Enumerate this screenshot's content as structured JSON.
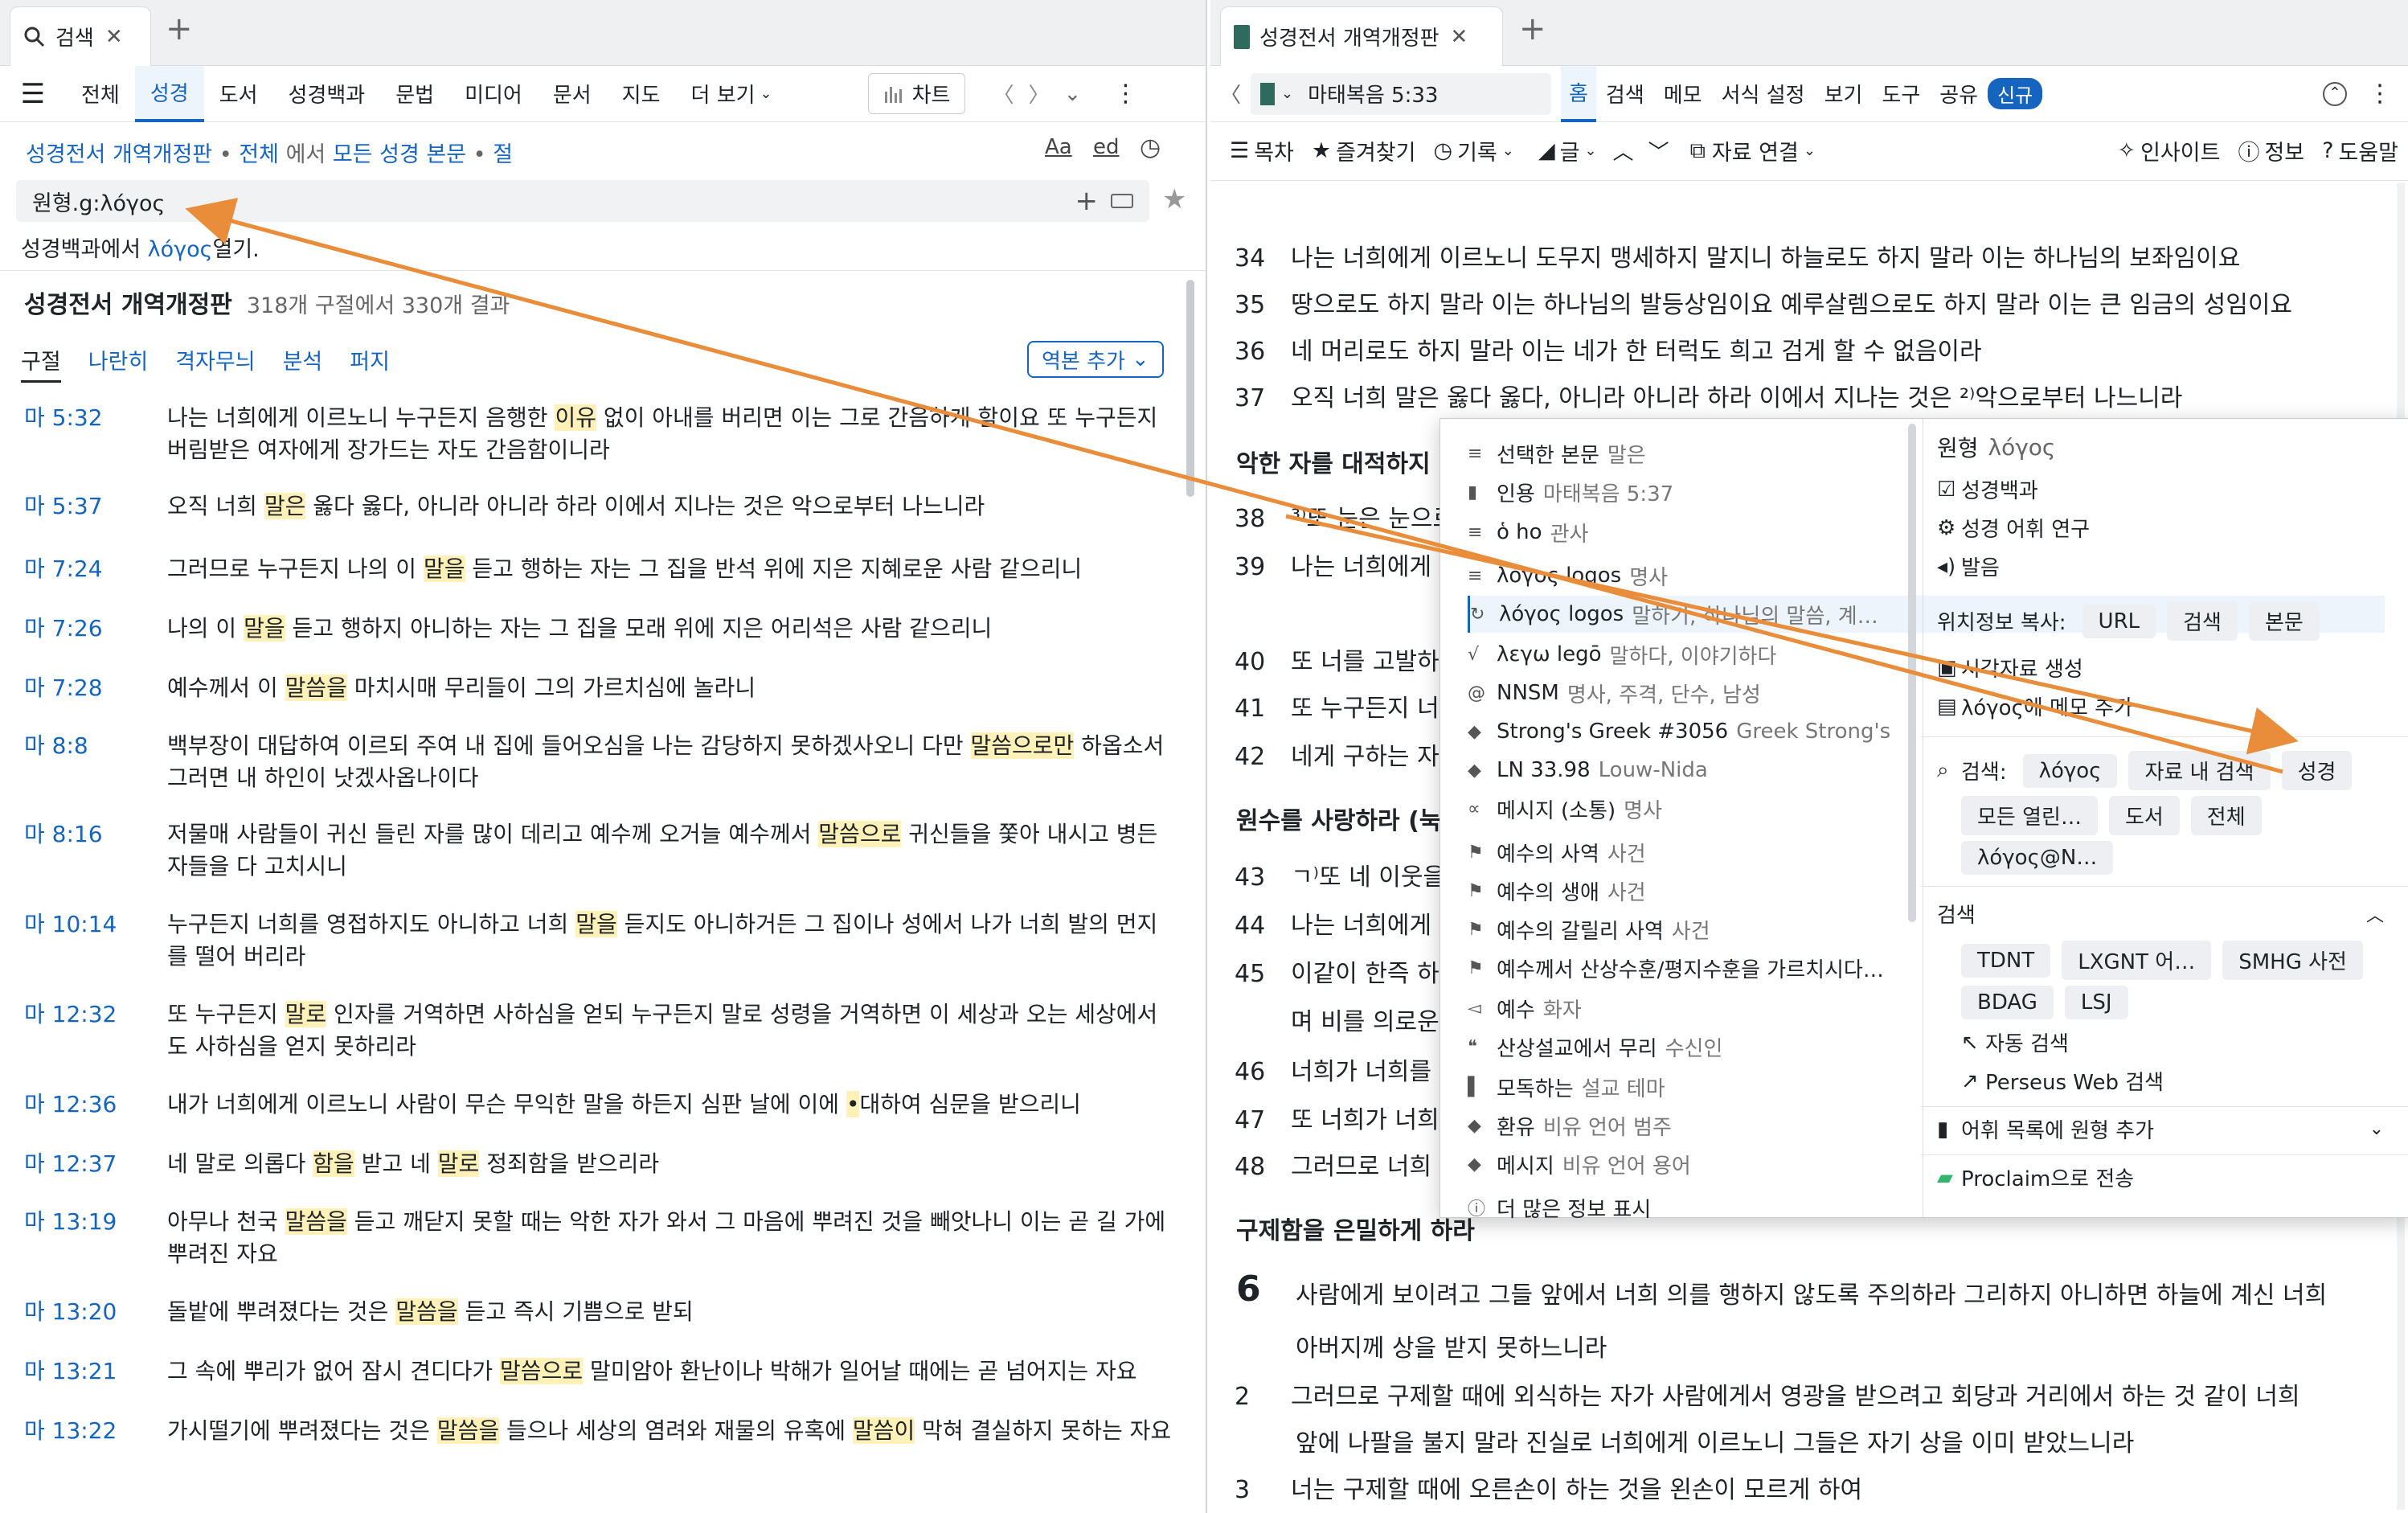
{
  "left": {
    "tab": {
      "title": "검색",
      "close": "✕",
      "new": "+"
    },
    "nav": {
      "menu": "☰",
      "items": [
        "전체",
        "성경",
        "도서",
        "성경백과",
        "문법",
        "미디어",
        "문서",
        "지도",
        "더 보기"
      ],
      "chart": "차트",
      "back": "〈",
      "fwd": "〉",
      "more": "⌄",
      "dots": "⋮"
    },
    "scope": {
      "version": "성경전서 개역개정판",
      "dot": "•",
      "all": "전체",
      "in": "에서",
      "target": "모든 성경 본문",
      "unit": "절",
      "tools": [
        "Aa",
        "ed"
      ]
    },
    "query": {
      "value": "원형.g:λόγος",
      "plus": "+",
      "star": "★"
    },
    "suggest": {
      "pre": "성경백과에서",
      "word": "λόγος",
      "post": "열기."
    },
    "results": {
      "title": "성경전서 개역개정판",
      "count": "318개 구절에서 330개 결과"
    },
    "subtabs": [
      "구절",
      "나란히",
      "격자무늬",
      "분석",
      "퍼지"
    ],
    "add_version": "역본 추가",
    "rows": [
      {
        "ref": "마 5:32",
        "parts": [
          [
            "나는 너희에게 이르노니 누구든지 음행한 ",
            0
          ],
          [
            "이유",
            1
          ],
          [
            " 없이 아내를 버리면 이는 그로 간음하게 함이요 또 누구든지 버림받은 여자에게 장가드는 자도 간음함이니라",
            0
          ]
        ]
      },
      {
        "ref": "마 5:37",
        "parts": [
          [
            "오직 너희 ",
            0
          ],
          [
            "말은",
            1
          ],
          [
            " 옳다 옳다, 아니라 아니라 하라 이에서 지나는 것은 악으로부터 나느니라",
            0
          ]
        ]
      },
      {
        "ref": "마 7:24",
        "parts": [
          [
            "그러므로 누구든지 나의 이 ",
            0
          ],
          [
            "말을",
            1
          ],
          [
            " 듣고 행하는 자는 그 집을 반석 위에 지은 지혜로운 사람 같으리니",
            0
          ]
        ]
      },
      {
        "ref": "마 7:26",
        "parts": [
          [
            "나의 이 ",
            0
          ],
          [
            "말을",
            1
          ],
          [
            " 듣고 행하지 아니하는 자는 그 집을 모래 위에 지은 어리석은 사람 같으리니",
            0
          ]
        ]
      },
      {
        "ref": "마 7:28",
        "parts": [
          [
            "예수께서 이 ",
            0
          ],
          [
            "말씀을",
            1
          ],
          [
            " 마치시매 무리들이 그의 가르치심에 놀라니",
            0
          ]
        ]
      },
      {
        "ref": "마 8:8",
        "parts": [
          [
            "백부장이 대답하여 이르되 주여 내 집에 들어오심을 나는 감당하지 못하겠사오니 다만 ",
            0
          ],
          [
            "말씀으로만",
            1
          ],
          [
            " 하옵소서 그러면 내 하인이 낫겠사옵나이다",
            0
          ]
        ]
      },
      {
        "ref": "마 8:16",
        "parts": [
          [
            "저물매 사람들이 귀신 들린 자를 많이 데리고 예수께 오거늘 예수께서 ",
            0
          ],
          [
            "말씀으로",
            1
          ],
          [
            " 귀신들을 쫓아 내시고 병든 자들을 다 고치시니",
            0
          ]
        ]
      },
      {
        "ref": "마 10:14",
        "parts": [
          [
            "누구든지 너희를 영접하지도 아니하고 너희 ",
            0
          ],
          [
            "말을",
            1
          ],
          [
            " 듣지도 아니하거든 그 집이나 성에서 나가 너희 발의 먼지를 떨어 버리라",
            0
          ]
        ]
      },
      {
        "ref": "마 12:32",
        "parts": [
          [
            "또 누구든지 ",
            0
          ],
          [
            "말로",
            1
          ],
          [
            " 인자를 거역하면 사하심을 얻되 누구든지 말로 성령을 거역하면 이 세상과 오는 세상에서도 사하심을 얻지 못하리라",
            0
          ]
        ]
      },
      {
        "ref": "마 12:36",
        "parts": [
          [
            "내가 너희에게 이르노니 사람이 무슨 무익한 말을 하든지 심판 날에 이에 ",
            0
          ],
          [
            "•",
            1
          ],
          [
            "대하여 심문을 받으리니",
            0
          ]
        ]
      },
      {
        "ref": "마 12:37",
        "parts": [
          [
            "네 말로 의롭다 ",
            0
          ],
          [
            "함을",
            1
          ],
          [
            " 받고 네 ",
            0
          ],
          [
            "말로",
            1
          ],
          [
            " 정죄함을 받으리라",
            0
          ]
        ]
      },
      {
        "ref": "마 13:19",
        "parts": [
          [
            "아무나 천국 ",
            0
          ],
          [
            "말씀을",
            1
          ],
          [
            " 듣고 깨닫지 못할 때는 악한 자가 와서 그 마음에 뿌려진 것을 빼앗나니 이는 곧 길 가에 뿌려진 자요",
            0
          ]
        ]
      },
      {
        "ref": "마 13:20",
        "parts": [
          [
            "돌밭에 뿌려졌다는 것은 ",
            0
          ],
          [
            "말씀을",
            1
          ],
          [
            " 듣고 즉시 기쁨으로 받되",
            0
          ]
        ]
      },
      {
        "ref": "마 13:21",
        "parts": [
          [
            "그 속에 뿌리가 없어 잠시 견디다가 ",
            0
          ],
          [
            "말씀으로",
            1
          ],
          [
            " 말미암아 환난이나 박해가 일어날 때에는 곧 넘어지는 자요",
            0
          ]
        ]
      },
      {
        "ref": "마 13:22",
        "parts": [
          [
            "가시떨기에 뿌려졌다는 것은 ",
            0
          ],
          [
            "말씀을",
            1
          ],
          [
            " 들으나 세상의 염려와 재물의 유혹에 ",
            0
          ],
          [
            "말씀이",
            1
          ],
          [
            " 막혀 결실하지 못하는 자요",
            0
          ]
        ]
      }
    ]
  },
  "right": {
    "tab": {
      "title": "성경전서 개역개정판",
      "close": "✕",
      "new": "+"
    },
    "nav": {
      "back": "〈",
      "ref": "마태복음 5:33",
      "items": [
        "홈",
        "검색",
        "메모",
        "서식 설정",
        "보기",
        "도구",
        "공유"
      ],
      "badge": "신규"
    },
    "toolbar": {
      "toc": "목차",
      "fav": "즐겨찾기",
      "history": "기록",
      "text": "글",
      "link": "자료 연결",
      "insight": "인사이트",
      "info": "정보",
      "help": "도움말"
    },
    "verses": [
      {
        "n": "34",
        "t": "나는 너희에게 이르노니 도무지 맹세하지 말지니 하늘로도 하지 말라 이는 하나님의 보좌임이요"
      },
      {
        "n": "35",
        "t": "땅으로도 하지 말라 이는 하나님의 발등상임이요 예루살렘으로도 하지 말라 이는 큰 임금의 성임이요"
      },
      {
        "n": "36",
        "t": "네 머리로도 하지 말라 이는 네가 한 터럭도 희고 검게 할 수 없음이라"
      },
      {
        "n": "37",
        "t": "오직 너희 말은 옳다 옳다, 아니라 아니라 하라 이에서 지나는 것은 ²⁾악으로부터 나느니라"
      }
    ],
    "heading1": "악한 자를 대적하지",
    "v38": {
      "n": "38",
      "t": "³⁾또 눈은 눈으로"
    },
    "v39": {
      "n": "39",
      "t": "나는 너희에게"
    },
    "verses2": [
      {
        "n": "40",
        "t": "또 너를 고발하"
      },
      {
        "n": "41",
        "t": "또 누구든지 너"
      },
      {
        "n": "42",
        "t": "네게 구하는 자"
      }
    ],
    "heading2": "원수를 사랑하라 (눅",
    "verses3": [
      {
        "n": "43",
        "t": "ㄱ⁾또 네 이웃을 사"
      },
      {
        "n": "44",
        "t": "나는 너희에게"
      },
      {
        "n": "45",
        "t": "이같이 한즉 하"
      },
      {
        "n": "",
        "t": "며 비를 의로운"
      },
      {
        "n": "46",
        "t": "너희가 너희를"
      },
      {
        "n": "47",
        "t": "또 너희가 너희"
      },
      {
        "n": "48",
        "t": "그러므로 너희"
      }
    ],
    "heading3": "구제함을 은밀하게 하라",
    "chapter": "6",
    "ch6": [
      {
        "n": "",
        "t": "사람에게 보이려고 그들 앞에서 너희 의를 행하지 않도록 주의하라 그리하지 아니하면 하늘에 계신 너희"
      },
      {
        "n": "",
        "t": "아버지께 상을 받지 못하느니라"
      },
      {
        "n": "2",
        "t": "그러므로 구제할 때에 외식하는 자가 사람에게서 영광을 받으려고 회당과 거리에서 하는 것 같이 너희"
      },
      {
        "n": "",
        "t": "앞에 나팔을 불지 말라 진실로 너희에게 이르노니 그들은 자기 상을 이미 받았느니라"
      },
      {
        "n": "3",
        "t": "너는 구제할 때에 오른손이 하는 것을 왼손이 모르게 하여"
      }
    ]
  },
  "ctx": {
    "items": [
      {
        "icon": "≡",
        "label": "선택한 본문",
        "sub": "말은"
      },
      {
        "icon": "▮",
        "label": "인용",
        "sub": "마태복음 5:37"
      },
      {
        "icon": "≡",
        "label": "ὁ ho",
        "sub": "관사"
      },
      {
        "icon": "≡",
        "label": "λόγος logos",
        "sub": "명사"
      },
      {
        "icon": "↻",
        "label": "λόγος logos",
        "sub": "말하기, 하나님의 말씀, 계…"
      },
      {
        "icon": "√",
        "label": "λεγω legō",
        "sub": "말하다, 이야기하다"
      },
      {
        "icon": "@",
        "label": "NNSM",
        "sub": "명사, 주격, 단수, 남성"
      },
      {
        "icon": "◆",
        "label": "Strong's Greek #3056",
        "sub": "Greek Strong's"
      },
      {
        "icon": "◆",
        "label": "LN 33.98",
        "sub": "Louw-Nida"
      },
      {
        "icon": "∝",
        "label": "메시지 (소통)",
        "sub": "명사"
      },
      {
        "icon": "⚑",
        "label": "예수의 사역",
        "sub": "사건"
      },
      {
        "icon": "⚑",
        "label": "예수의 생애",
        "sub": "사건"
      },
      {
        "icon": "⚑",
        "label": "예수의 갈릴리 사역",
        "sub": "사건"
      },
      {
        "icon": "⚑",
        "label": "예수께서 산상수훈/평지수훈을 가르치시다…",
        "sub": ""
      },
      {
        "icon": "◅",
        "label": "예수",
        "sub": "화자"
      },
      {
        "icon": "❝",
        "label": "산상설교에서 무리",
        "sub": "수신인"
      },
      {
        "icon": "▌",
        "label": "모독하는",
        "sub": "설교 테마"
      },
      {
        "icon": "◆",
        "label": "환유",
        "sub": "비유 언어 범주"
      },
      {
        "icon": "◆",
        "label": "메시지",
        "sub": "비유 언어 용어"
      },
      {
        "icon": "ⓘ",
        "label": "더 많은 정보 표시",
        "sub": ""
      }
    ],
    "panel": {
      "title": "원형",
      "word": "λόγος",
      "links": [
        "성경백과",
        "성경 어휘 연구",
        "발음"
      ],
      "copy_label": "위치정보 복사:",
      "copy": [
        "URL",
        "검색",
        "본문"
      ],
      "actions": [
        "시각자료 생성",
        "λόγος에 메모 추가"
      ],
      "search_label": "검색:",
      "search_row1": [
        "λόγος",
        "자료 내 검색",
        "성경"
      ],
      "search_row2": [
        "모든 열린…",
        "도서",
        "전체"
      ],
      "search_row3": [
        "λόγος@N…"
      ],
      "sec": "검색",
      "sec_row1": [
        "TDNT",
        "LXGNT 어…",
        "SMHG 사전"
      ],
      "sec_row2": [
        "BDAG",
        "LSJ"
      ],
      "auto": "자동 검색",
      "perseus": "Perseus Web 검색",
      "add_list": "어휘 목록에 원형 추가",
      "proclaim": "Proclaim으로 전송"
    }
  }
}
